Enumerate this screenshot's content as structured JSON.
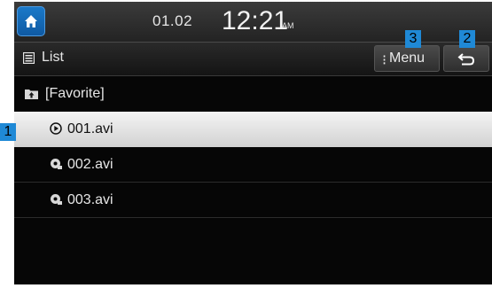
{
  "status": {
    "date": "01.02",
    "time": "12:21",
    "ampm": "AM"
  },
  "header": {
    "title": "List",
    "menu_label": "Menu"
  },
  "folder": {
    "label": "[Favorite]"
  },
  "files": [
    {
      "name": "001.avi",
      "selected": true,
      "icon": "play-circle-icon"
    },
    {
      "name": "002.avi",
      "selected": false,
      "icon": "video-file-icon"
    },
    {
      "name": "003.avi",
      "selected": false,
      "icon": "video-file-icon"
    }
  ],
  "callouts": {
    "one": "1",
    "two": "2",
    "three": "3"
  },
  "colors": {
    "accent_blue": "#1f89d6",
    "selected_row": "#e4e4e4",
    "background": "#060606"
  }
}
